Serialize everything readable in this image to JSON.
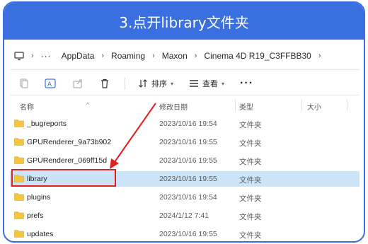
{
  "banner": {
    "title": "3.点开library文件夹"
  },
  "address": {
    "icon": "monitor-icon",
    "crumbs": [
      "AppData",
      "Roaming",
      "Maxon",
      "Cinema 4D R19_C3FFBB30"
    ],
    "ellipsis": "···"
  },
  "toolbar": {
    "sort_label": "排序",
    "view_label": "查看",
    "more_label": "···"
  },
  "columns": {
    "name": "名称",
    "date": "修改日期",
    "type": "类型",
    "size": "大小"
  },
  "files": [
    {
      "name": "_bugreports",
      "date": "2023/10/16 19:54",
      "type": "文件夹"
    },
    {
      "name": "GPURenderer_9a73b902",
      "date": "2023/10/16 19:55",
      "type": "文件夹"
    },
    {
      "name": "GPURenderer_069ff15d",
      "date": "2023/10/16 19:55",
      "type": "文件夹"
    },
    {
      "name": "library",
      "date": "2023/10/16 19:55",
      "type": "文件夹",
      "selected": true
    },
    {
      "name": "plugins",
      "date": "2023/10/16 19:54",
      "type": "文件夹"
    },
    {
      "name": "prefs",
      "date": "2024/1/12 7:41",
      "type": "文件夹"
    },
    {
      "name": "updates",
      "date": "2023/10/16 19:55",
      "type": "文件夹"
    }
  ],
  "colors": {
    "accent": "#3a6fe0",
    "selection": "#cce4f7",
    "annotation": "#e02020",
    "folder": "#f5c542"
  }
}
